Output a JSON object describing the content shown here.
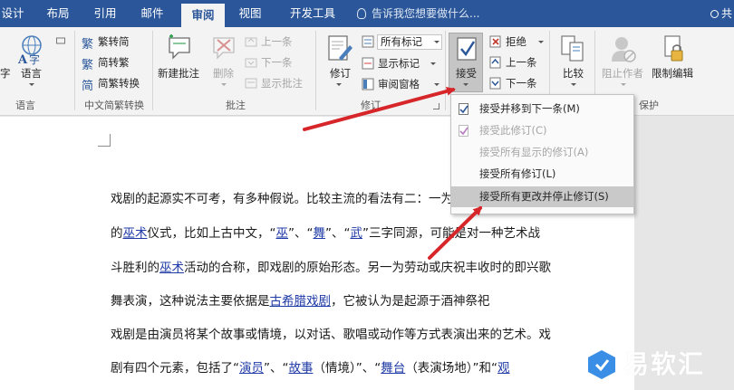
{
  "tabs": {
    "design": "设计",
    "layout": "布局",
    "references": "引用",
    "mailings": "邮件",
    "review": "审阅",
    "view": "视图",
    "developer": "开发工具"
  },
  "tell_me": "告诉我您想要做什么...",
  "share": "共享",
  "ribbon": {
    "proofing": {
      "spelling_partial": "字",
      "language": "语言",
      "group_label": "语言"
    },
    "chinese_conversion": {
      "to_traditional": "繁转简",
      "to_simplified": "简转繁",
      "conversion": "简繁转换",
      "group_label": "中文简繁转换"
    },
    "comments": {
      "new_comment": "新建批注",
      "delete": "删除",
      "previous": "上一条",
      "next": "下一条",
      "show_comments": "显示批注",
      "group_label": "批注"
    },
    "tracking": {
      "track_changes": "修订",
      "all_markup": "所有标记",
      "show_markup": "显示标记",
      "reviewing_pane": "审阅窗格",
      "group_label": "修订"
    },
    "changes": {
      "accept": "接受",
      "reject": "拒绝",
      "previous": "上一条",
      "next": "下一条"
    },
    "compare": {
      "compare": "比较"
    },
    "protect": {
      "block_authors": "阻止作者",
      "restrict_editing": "限制编辑",
      "group_label": "保护"
    }
  },
  "accept_menu": {
    "items": [
      {
        "label": "接受并移到下一条(M)",
        "enabled": true
      },
      {
        "label": "接受此修订(C)",
        "enabled": false
      },
      {
        "label": "接受所有显示的修订(A)",
        "enabled": false
      },
      {
        "label": "接受所有修订(L)",
        "enabled": true
      },
      {
        "label": "接受所有更改并停止修订(S)",
        "enabled": true,
        "hovered": true
      }
    ]
  },
  "document": {
    "lines": [
      {
        "pre": "戏剧的起源实不可考，有多种假说。比较主流的看法有二：一为原"
      },
      {
        "pre": "的",
        "link1": "巫术",
        "mid1": "仪式，比如上古中文，“",
        "link2": "巫",
        "mid2": "”、“",
        "link3": "舞",
        "mid3": "”、“",
        "link4": "武",
        "post": "”三字同源，可能是对一种艺术战"
      },
      {
        "pre": "斗胜利的",
        "link1": "巫术",
        "post": "活动的合称，即戏剧的原始形态。另一为劳动或庆祝丰收时的即兴歌"
      },
      {
        "pre": "舞表演，这种说法主要依据是",
        "link1": "古希腊戏剧",
        "post": "，它被认为是起源于酒神祭祀"
      },
      {
        "pre": "戏剧是由演员将某个故事或情境，以对话、歌唱或动作等方式表演出来的艺术。戏"
      },
      {
        "pre": "剧有四个元素，包括了“",
        "link1": "演员",
        "mid1": "”、“",
        "link2": "故事",
        "mid2": "（情境）”、“",
        "link3": "舞台",
        "post": "（表演场地）”和“",
        "link4": "观"
      }
    ]
  },
  "watermark": {
    "text": "易软汇"
  },
  "colors": {
    "title_bar": "#2b579a",
    "ribbon_bg": "#f3f3f3",
    "menu_hover": "#c9c9c9",
    "arrow": "#d6262a",
    "link": "#1f3aa6"
  }
}
